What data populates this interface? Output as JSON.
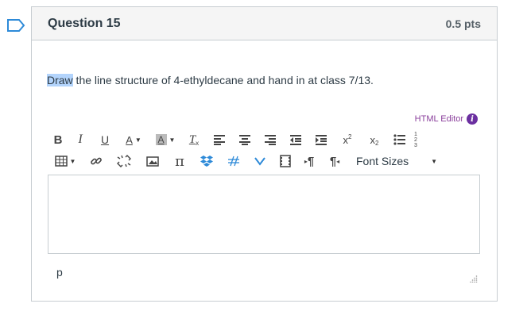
{
  "question": {
    "title": "Question 15",
    "points": "0.5 pts",
    "text_highlighted": "Draw",
    "text_rest": " the line structure of 4-ethyldecane and hand in at class 7/13."
  },
  "editor": {
    "html_editor_label": "HTML Editor",
    "font_sizes_label": "Font Sizes",
    "status_path": "p"
  },
  "toolbar_icons": {
    "row1": [
      "bold-icon",
      "italic-icon",
      "underline-icon",
      "text-color-icon",
      "background-color-icon",
      "clear-formatting-icon",
      "align-left-icon",
      "align-center-icon",
      "align-right-icon",
      "outdent-icon",
      "indent-icon",
      "superscript-icon",
      "subscript-icon",
      "bullet-list-icon",
      "numbered-list-icon"
    ],
    "row2": [
      "table-icon",
      "link-icon",
      "unlink-icon",
      "image-icon",
      "math-equation-icon",
      "dropbox-icon",
      "unlink-embed-icon",
      "media-icon",
      "video-icon",
      "ltr-icon",
      "rtl-icon"
    ]
  },
  "colors": {
    "highlight": "#b3d4fc",
    "html_editor_link": "#8a3e9b",
    "info_icon": "#6b2fa0",
    "dropbox": "#2e8ad8",
    "border": "#c7cdd1"
  }
}
